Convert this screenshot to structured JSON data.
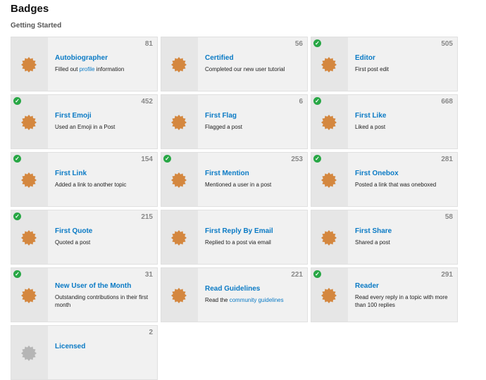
{
  "page": {
    "title": "Badges",
    "section": "Getting Started"
  },
  "colors": {
    "badge_bronze": "#d4873f",
    "badge_gray": "#b5b5b5",
    "granted_check": "#28a745",
    "link": "#0a7ac5"
  },
  "badges": [
    {
      "name": "Autobiographer",
      "count": "81",
      "granted": false,
      "icon_color": "#d4873f",
      "desc": {
        "pre": "Filled out ",
        "link": "profile",
        "post": " information"
      }
    },
    {
      "name": "Certified",
      "count": "56",
      "granted": false,
      "icon_color": "#d4873f",
      "desc": {
        "pre": "Completed our new user tutorial"
      }
    },
    {
      "name": "Editor",
      "count": "505",
      "granted": true,
      "icon_color": "#d4873f",
      "desc": {
        "pre": "First post edit"
      }
    },
    {
      "name": "First Emoji",
      "count": "452",
      "granted": true,
      "icon_color": "#d4873f",
      "desc": {
        "pre": "Used an Emoji in a Post"
      }
    },
    {
      "name": "First Flag",
      "count": "6",
      "granted": false,
      "icon_color": "#d4873f",
      "desc": {
        "pre": "Flagged a post"
      }
    },
    {
      "name": "First Like",
      "count": "668",
      "granted": true,
      "icon_color": "#d4873f",
      "desc": {
        "pre": "Liked a post"
      }
    },
    {
      "name": "First Link",
      "count": "154",
      "granted": true,
      "icon_color": "#d4873f",
      "desc": {
        "pre": "Added a link to another topic"
      }
    },
    {
      "name": "First Mention",
      "count": "253",
      "granted": true,
      "icon_color": "#d4873f",
      "desc": {
        "pre": "Mentioned a user in a post"
      }
    },
    {
      "name": "First Onebox",
      "count": "281",
      "granted": true,
      "icon_color": "#d4873f",
      "desc": {
        "pre": "Posted a link that was oneboxed"
      }
    },
    {
      "name": "First Quote",
      "count": "215",
      "granted": true,
      "icon_color": "#d4873f",
      "desc": {
        "pre": "Quoted a post"
      }
    },
    {
      "name": "First Reply By Email",
      "count": "",
      "granted": false,
      "icon_color": "#d4873f",
      "desc": {
        "pre": "Replied to a post via email"
      }
    },
    {
      "name": "First Share",
      "count": "58",
      "granted": false,
      "icon_color": "#d4873f",
      "desc": {
        "pre": "Shared a post"
      }
    },
    {
      "name": "New User of the Month",
      "count": "31",
      "granted": true,
      "icon_color": "#d4873f",
      "desc": {
        "pre": "Outstanding contributions in their first month"
      }
    },
    {
      "name": "Read Guidelines",
      "count": "221",
      "granted": false,
      "icon_color": "#d4873f",
      "desc": {
        "pre": "Read the ",
        "link": "community guidelines"
      }
    },
    {
      "name": "Reader",
      "count": "291",
      "granted": true,
      "icon_color": "#d4873f",
      "desc": {
        "pre": "Read every reply in a topic with more than 100 replies"
      }
    },
    {
      "name": "Licensed",
      "count": "2",
      "granted": false,
      "icon_color": "#b5b5b5",
      "desc": {
        "pre": ""
      }
    }
  ]
}
